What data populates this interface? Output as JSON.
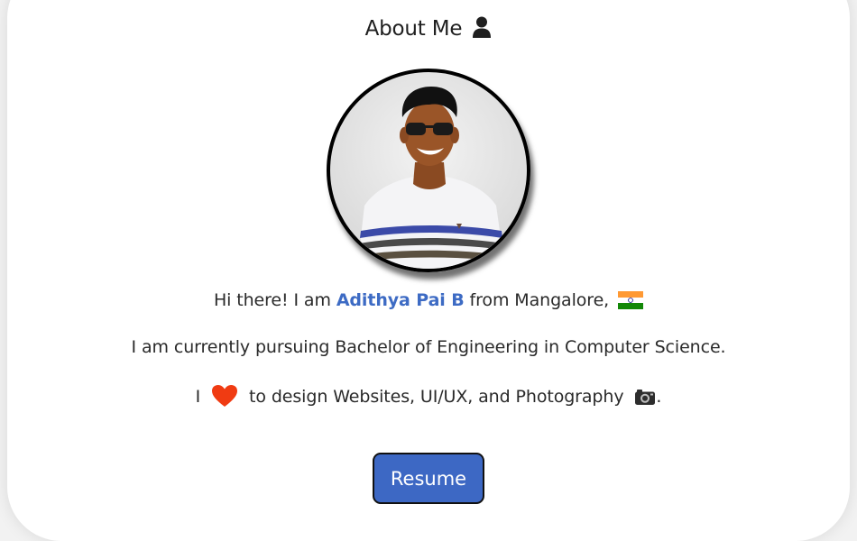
{
  "section": {
    "title": "About Me",
    "title_icon": "user-icon"
  },
  "profile": {
    "photo_alt": "profile-photo"
  },
  "intro": {
    "greeting_prefix": "Hi there! I am ",
    "name": "Adithya Pai B",
    "greeting_suffix": " from Mangalore, ",
    "flag_icon": "india-flag-icon",
    "education": "I am currently pursuing Bachelor of Engineering in Computer Science.",
    "love_prefix": "I ",
    "heart_icon": "heart-icon",
    "love_text": " to design Websites, UI/UX, and Photography ",
    "camera_icon": "camera-icon",
    "love_suffix": "."
  },
  "actions": {
    "resume_label": "Resume"
  },
  "colors": {
    "accent": "#3d6bc4",
    "button_bg": "#3d68c4",
    "heart": "#f03b12"
  }
}
